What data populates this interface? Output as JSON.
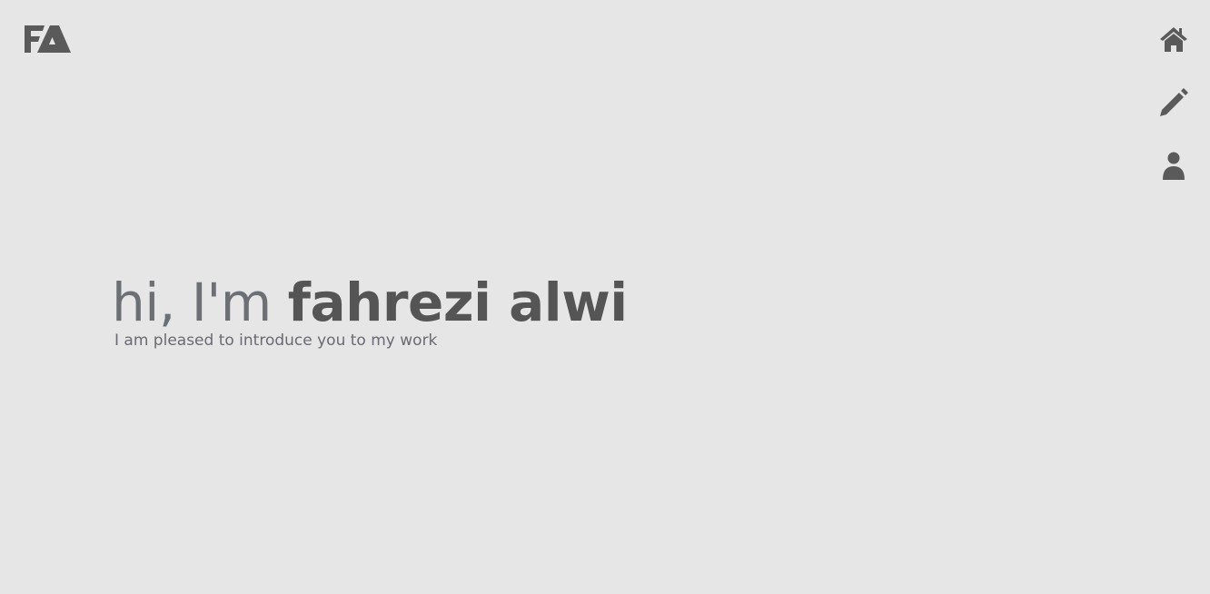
{
  "logo": {
    "text": "FA"
  },
  "nav": [
    {
      "label": "home",
      "icon": "home-icon"
    },
    {
      "label": "blog",
      "icon": "pencil-icon"
    },
    {
      "label": "about",
      "icon": "user-icon"
    }
  ],
  "hero": {
    "greeting": "hi, I'm ",
    "name": "fahrezi alwi",
    "subtitle": "I am pleased to introduce you to my work"
  },
  "colors": {
    "background": "#e6e6e6",
    "foreground": "#585858"
  }
}
